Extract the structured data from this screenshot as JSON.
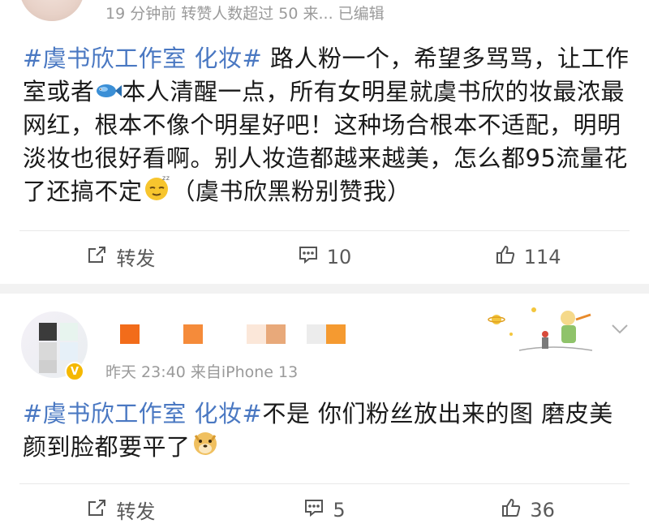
{
  "post1": {
    "meta": "19 分钟前  转赞人数超过 50   来...   已编辑",
    "tag": "#虞书欣工作室 化妆#",
    "text_part1": " 路人粉一个，希望多骂骂，让工作室或者",
    "fish_icon": "fish-icon",
    "text_part2": "本人清醒一点，所有女明星就虞书欣的妆最浓最网红，根本不像个明星好吧！这种场合根本不适配，明明淡妆也很好看啊。别人妆造都越来越美，怎么都95流量花了还搞不定",
    "sleepy_icon": "sleepy-face-icon",
    "text_part3": "（虞书欣黑粉别赞我）",
    "actions": {
      "repost_label": "转发",
      "comment_count": "10",
      "like_count": "114"
    }
  },
  "post2": {
    "meta": "昨天 23:40  来自iPhone 13",
    "verified_icon": "verified-badge-icon",
    "tag": "#虞书欣工作室 化妆#",
    "text": "不是 你们粉丝放出来的图 磨皮美颜到脸都要平了",
    "doge_icon": "doge-icon",
    "actions": {
      "repost_label": "转发",
      "comment_count": "5",
      "like_count": "36"
    }
  },
  "colors": {
    "tag": "#4a78c2",
    "meta": "#9a9a9a",
    "name_block_1": "#f26c1a",
    "name_block_2": "#f58b3a",
    "name_block_3": "#e8a97a",
    "name_block_4": "#f59a30",
    "separator": "#f2f2f2"
  }
}
